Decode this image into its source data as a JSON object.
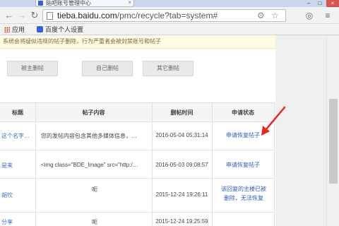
{
  "browser": {
    "tab_title": "贴吧账号管理中心",
    "url_host": "tieba.baidu.com",
    "url_path": "/pmc/recycle?tab=system#"
  },
  "bookmarks": [
    {
      "label": "应用",
      "icon": "apps-grid-icon"
    },
    {
      "label": "百度个人设置",
      "icon": "baidu-paw-icon"
    }
  ],
  "notice": {
    "text": "系统会将疑似违规的帖子删除，行为严重者会被封禁账号和帖子"
  },
  "subtabs": [
    {
      "label": "被主删帖"
    },
    {
      "label": "自己删帖"
    },
    {
      "label": "其它删帖"
    }
  ],
  "table": {
    "headers": [
      "标题",
      "帖子内容",
      "删帖时间",
      "申请状态"
    ],
    "rows": [
      {
        "title": "这个名字…",
        "content": "您的发帖内容包含其他多媒体信息，…",
        "time": "2016-05-04 05:31:14",
        "status": "申请恢复帖子"
      },
      {
        "title": "是来",
        "content": "<img class=\"BDE_Image\" src=\"http:/…",
        "time": "2016-05-03 09:08:57",
        "status": "申请恢复帖子"
      },
      {
        "title": "胡坎",
        "content": "呃",
        "time": "2015-12-24 19:26:11",
        "status": "该回复的主楼已被删除，无法恢复"
      },
      {
        "title": "分享",
        "content": "呃",
        "time": "2015-12-24 19:25:59",
        "status": ""
      }
    ]
  },
  "colors": {
    "link": "#2a5fbf",
    "annotation_arrow": "#e8271f"
  }
}
